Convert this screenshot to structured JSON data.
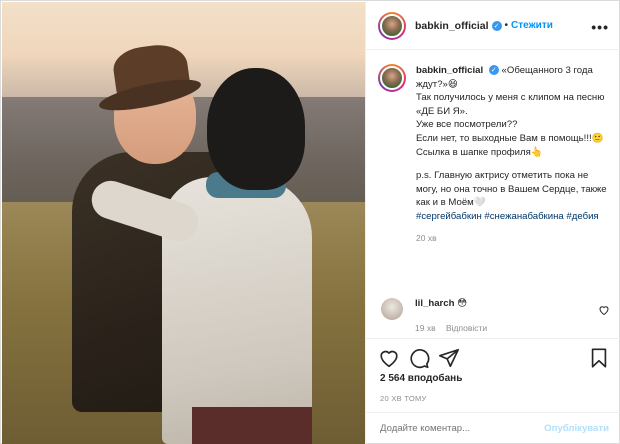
{
  "post": {
    "author": "babkin_official",
    "follow_label": "Стежити",
    "separator": "•",
    "more_label": "•••"
  },
  "caption": {
    "author": "babkin_official",
    "lines": [
      "«Обещанного 3 года ждут?»😆",
      "Так получилось у меня с клипом на песню «ДЕ БИ Я».",
      "Уже все посмотрели??",
      "Если нет, то выходные Вам в помощь!!!🙂",
      "Ссылка в шапке профиля👆",
      "p.s. Главную актрису отметить пока не могу, но она точно в Вашем Сердце, также как и в Моём🤍"
    ],
    "hashtags": "#сергейбабкин #снежанабабкина #дебия",
    "time": "20 хв"
  },
  "comment": {
    "author": "lil_harch",
    "text": "😳",
    "time": "19 хв",
    "reply_label": "Відповісти"
  },
  "likes": "2 564 вподобань",
  "posted_ago": "20 ХВ ТОМУ",
  "add_comment": {
    "placeholder": "Додайте коментар...",
    "publish_label": "Опублікувати"
  },
  "icons": {
    "like": "heart-icon",
    "comment": "comment-icon",
    "share": "send-icon",
    "save": "bookmark-icon",
    "verified": "verified-badge-icon",
    "options": "more-options-icon"
  },
  "colors": {
    "accent": "#0095f6",
    "link": "#00376b",
    "muted": "#8e8e8e",
    "verified": "#3897f0"
  }
}
